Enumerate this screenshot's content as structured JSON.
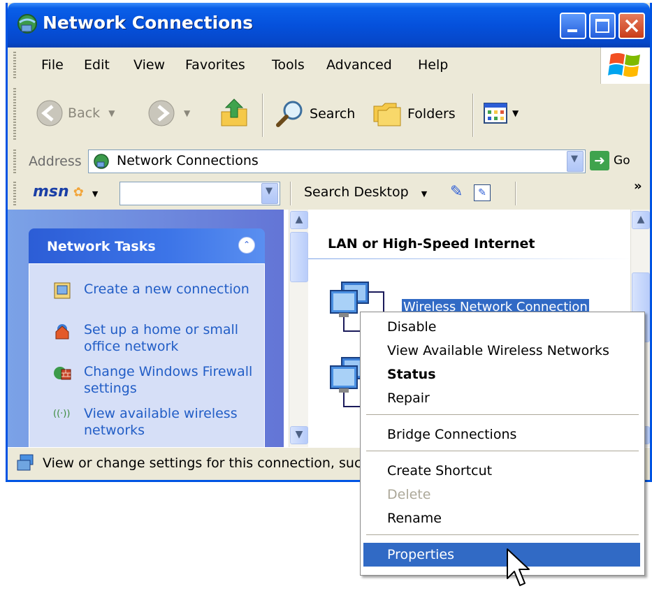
{
  "window": {
    "title": "Network Connections"
  },
  "menu": [
    {
      "label": "File"
    },
    {
      "label": "Edit"
    },
    {
      "label": "View"
    },
    {
      "label": "Favorites"
    },
    {
      "label": "Tools"
    },
    {
      "label": "Advanced"
    },
    {
      "label": "Help"
    }
  ],
  "toolbar": {
    "back": "Back",
    "search": "Search",
    "folders": "Folders"
  },
  "address": {
    "label": "Address",
    "value": "Network Connections",
    "go": "Go"
  },
  "msn": {
    "logo": "msn",
    "search_desktop": "Search Desktop",
    "more": "»"
  },
  "tasks": {
    "title": "Network Tasks",
    "items": [
      {
        "label": "Create a new connection",
        "icon": "new-connection-icon"
      },
      {
        "label": "Set up a home or small office network",
        "icon": "home-network-icon"
      },
      {
        "label": "Change Windows Firewall settings",
        "icon": "firewall-icon"
      },
      {
        "label": "View available wireless networks",
        "icon": "wireless-icon"
      }
    ]
  },
  "content": {
    "group_title": "LAN or High-Speed Internet",
    "connection_label": "Wireless Network Connection"
  },
  "status": {
    "text": "View or change settings for this connection, suc"
  },
  "context_menu": {
    "disable": "Disable",
    "view_wireless": "View Available Wireless Networks",
    "status": "Status",
    "repair": "Repair",
    "bridge": "Bridge Connections",
    "shortcut": "Create Shortcut",
    "delete": "Delete",
    "rename": "Rename",
    "properties": "Properties"
  },
  "colors": {
    "titlebar": "#0551dc",
    "selection": "#316ac5",
    "taskpane": "#7ba2e7",
    "link": "#215dc6"
  }
}
